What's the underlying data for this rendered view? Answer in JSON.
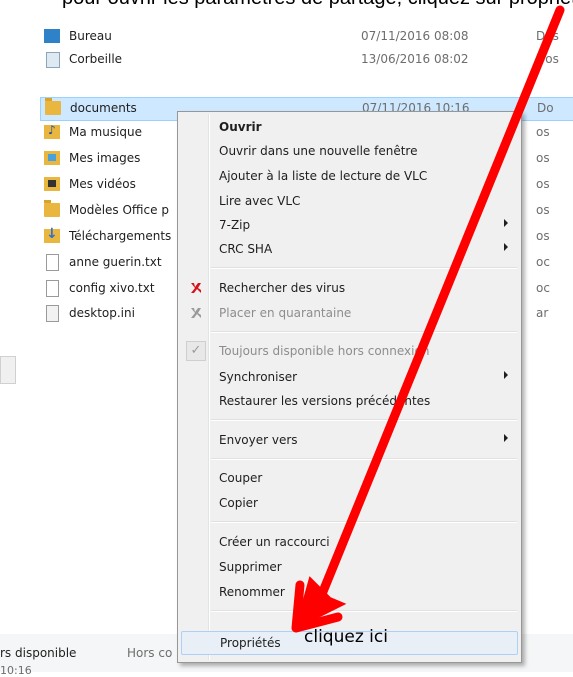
{
  "caption": "pour ouvrir les paramètres de partage, cliquez sur propriétés",
  "files": [
    {
      "name": "Bureau",
      "date": "07/11/2016 08:08",
      "type": "Dos",
      "icon": "bureau-folder-icon"
    },
    {
      "name": "Corbeille",
      "date": "13/06/2016 08:02",
      "type": "Dos",
      "icon": "recycle-bin-icon"
    },
    {
      "name": "documents",
      "date": "07/11/2016 10:16",
      "type": "Do",
      "icon": "folder-icon"
    },
    {
      "name": "Ma musique",
      "date": "",
      "type": "os",
      "icon": "music-folder-icon"
    },
    {
      "name": "Mes images",
      "date": "",
      "type": "os",
      "icon": "images-folder-icon"
    },
    {
      "name": "Mes vidéos",
      "date": "",
      "type": "os",
      "icon": "videos-folder-icon"
    },
    {
      "name": "Modèles Office p",
      "date": "",
      "type": "os",
      "icon": "folder-icon"
    },
    {
      "name": "Téléchargements",
      "date": "",
      "type": "os",
      "icon": "downloads-folder-icon"
    },
    {
      "name": "anne guerin.txt",
      "date": "",
      "type": "oc",
      "icon": "text-file-icon"
    },
    {
      "name": "config xivo.txt",
      "date": "",
      "type": "oc",
      "icon": "text-file-icon"
    },
    {
      "name": "desktop.ini",
      "date": "",
      "type": "ar",
      "icon": "ini-file-icon"
    }
  ],
  "menu": {
    "open": "Ouvrir",
    "open_new_window": "Ouvrir dans une nouvelle fenêtre",
    "add_vlc_playlist": "Ajouter à la liste de lecture de VLC",
    "play_vlc": "Lire avec VLC",
    "zip": "7-Zip",
    "crc": "CRC SHA",
    "scan_virus": "Rechercher des virus",
    "quarantine": "Placer en quarantaine",
    "always_available": "Toujours disponible hors connexion",
    "sync": "Synchroniser",
    "restore": "Restaurer les versions précédentes",
    "send_to": "Envoyer vers",
    "cut": "Couper",
    "copy": "Copier",
    "create_shortcut": "Créer un raccourci",
    "delete": "Supprimer",
    "rename": "Renommer",
    "properties": "Propriétés"
  },
  "status": {
    "availability": "rs disponible",
    "offline": "Hors co",
    "time_partial": "10:16"
  },
  "annotation": "cliquez ici",
  "colors": {
    "selection": "#cde8ff",
    "arrow": "#ff0000",
    "menu_bg": "#f0f0f0"
  }
}
